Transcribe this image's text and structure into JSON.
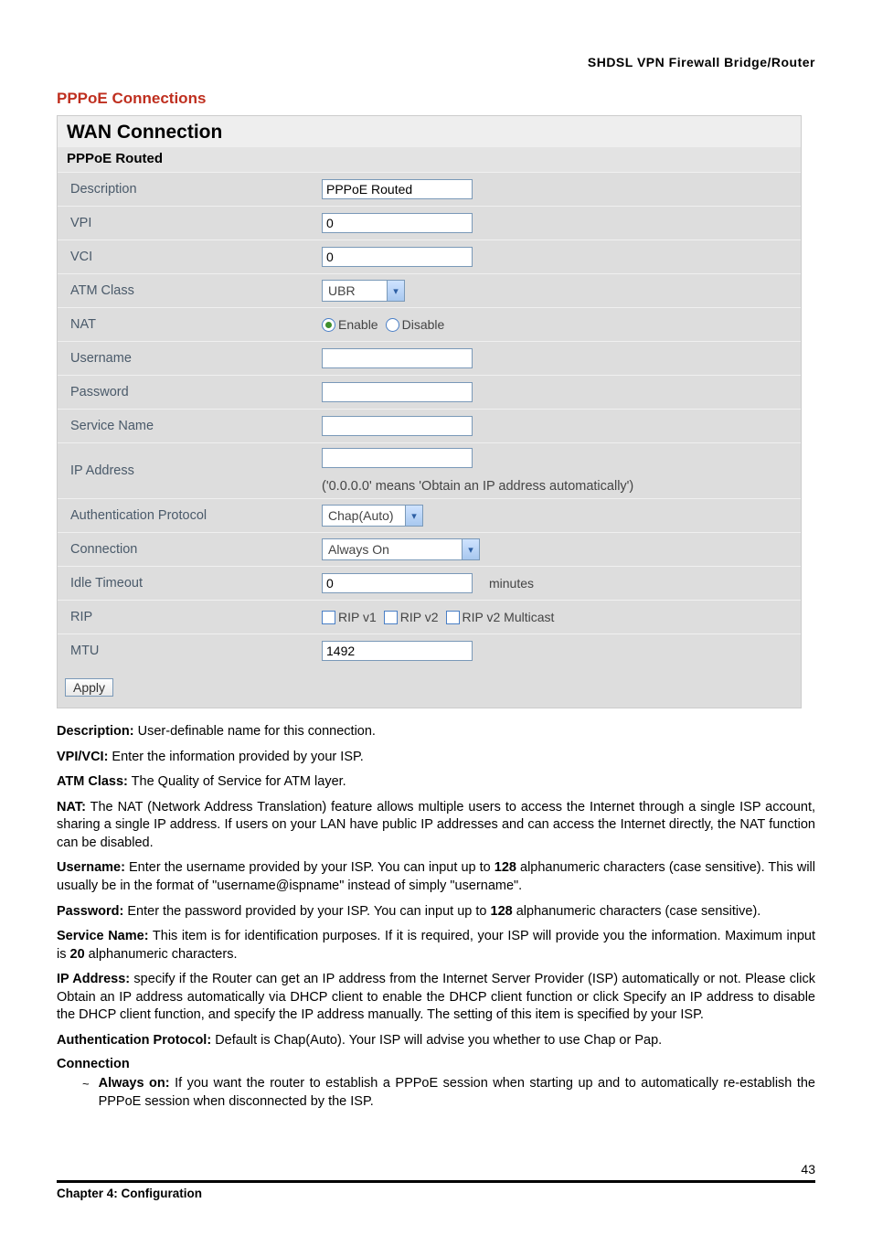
{
  "header": {
    "right": "SHDSL  VPN  Firewall  Bridge/Router"
  },
  "section_title": "PPPoE Connections",
  "panel": {
    "title": "WAN Connection",
    "subtitle": "PPPoE Routed",
    "labels": {
      "description": "Description",
      "vpi": "VPI",
      "vci": "VCI",
      "atm": "ATM Class",
      "nat": "NAT",
      "user": "Username",
      "pass": "Password",
      "svc": "Service Name",
      "ip": "IP Address",
      "auth": "Authentication Protocol",
      "conn": "Connection",
      "idle": "Idle Timeout",
      "rip": "RIP",
      "mtu": "MTU"
    },
    "values": {
      "description": "PPPoE Routed",
      "vpi": "0",
      "vci": "0",
      "atm_selected": "UBR",
      "nat_enable": "Enable",
      "nat_disable": "Disable",
      "username": "",
      "password": "",
      "service_name": "",
      "ip_address": "",
      "ip_help": "('0.0.0.0' means 'Obtain an IP address automatically')",
      "auth_selected": "Chap(Auto)",
      "conn_selected": "Always On",
      "idle": "0",
      "idle_unit": "minutes",
      "rip_v1": "RIP v1",
      "rip_v2": "RIP v2",
      "rip_v2m": "RIP v2 Multicast",
      "mtu": "1492"
    },
    "apply": "Apply"
  },
  "body": {
    "p1": {
      "b": "Description:",
      "t": " User-definable name for this connection."
    },
    "p2": {
      "b": "VPI/VCI:",
      "t": " Enter the information provided by your ISP."
    },
    "p3": {
      "b": "ATM Class:",
      "t": " The Quality of Service for ATM layer."
    },
    "p4": {
      "b": "NAT:",
      "t": " The NAT (Network Address Translation) feature allows multiple users to access the Internet through a single ISP account, sharing a single IP address. If users on your LAN have public IP addresses and can access the Internet directly, the NAT function can be disabled."
    },
    "p5": {
      "b": "Username:",
      "t1": " Enter the username provided by your ISP. You can input up to ",
      "n": "128",
      "t2": " alphanumeric characters (case sensitive). This will usually be in the format of \"username@ispname\" instead of simply \"username\"."
    },
    "p6": {
      "b": "Password:",
      "t1": " Enter the password provided by your ISP. You can input up to ",
      "n": "128",
      "t2": " alphanumeric characters (case sensitive)."
    },
    "p7": {
      "b": "Service Name:",
      "t1": " This item is for identification purposes. If it is required, your ISP will provide you the information. Maximum input is ",
      "n": "20",
      "t2": " alphanumeric characters."
    },
    "p8": {
      "b": "IP Address:",
      "t": " specify if the Router can get an IP address from the Internet Server Provider (ISP) automatically or not. Please click Obtain an IP address automatically via DHCP client to enable the DHCP client function or click Specify an IP address to disable the DHCP client function, and specify the IP address manually. The setting of this item is specified by your ISP."
    },
    "p9": {
      "b": "Authentication Protocol:",
      "t": " Default is Chap(Auto). Your ISP will advise you whether to use Chap or Pap."
    },
    "conn_head": "Connection",
    "bullet": {
      "sym": "~",
      "b": "Always on:",
      "t": " If you want the router to establish a PPPoE session when starting up and to automatically re-establish the PPPoE session when disconnected by the ISP."
    }
  },
  "footer": {
    "page": "43",
    "chapter": "Chapter 4: Configuration"
  }
}
